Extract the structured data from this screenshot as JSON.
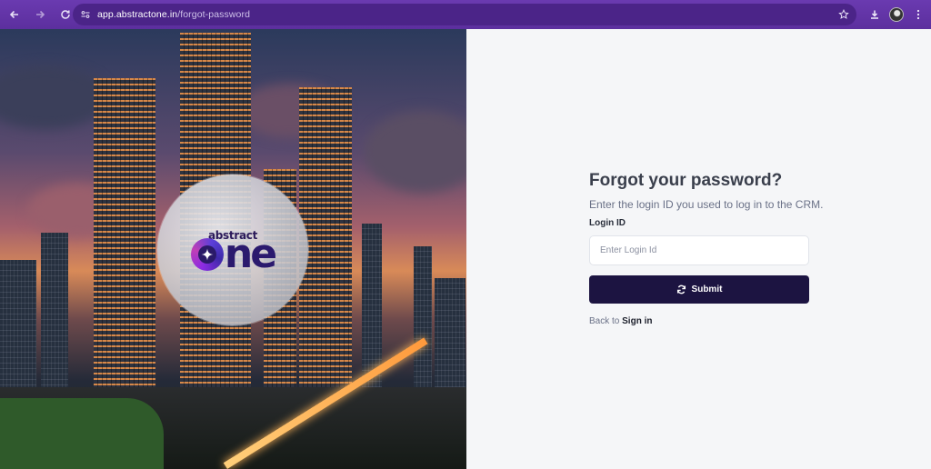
{
  "browser": {
    "url_host": "app.abstractone.in",
    "url_path": "/forgot-password",
    "icons": [
      "back-arrow-icon",
      "forward-arrow-icon",
      "reload-icon",
      "site-info-icon",
      "bookmark-star-icon",
      "download-icon",
      "profile-avatar",
      "menu-dots-icon"
    ]
  },
  "brand": {
    "logo_top": "abstract",
    "logo_main": "ne",
    "accent": "#1c1441",
    "chrome": "#5c2f9e"
  },
  "form": {
    "title": "Forgot your password?",
    "subtitle": "Enter the login ID you used to log in to the CRM.",
    "login_label": "Login ID",
    "login_placeholder": "Enter Login Id",
    "login_value": "",
    "submit_label": "Submit",
    "back_prefix": "Back to",
    "back_link": "Sign in"
  }
}
